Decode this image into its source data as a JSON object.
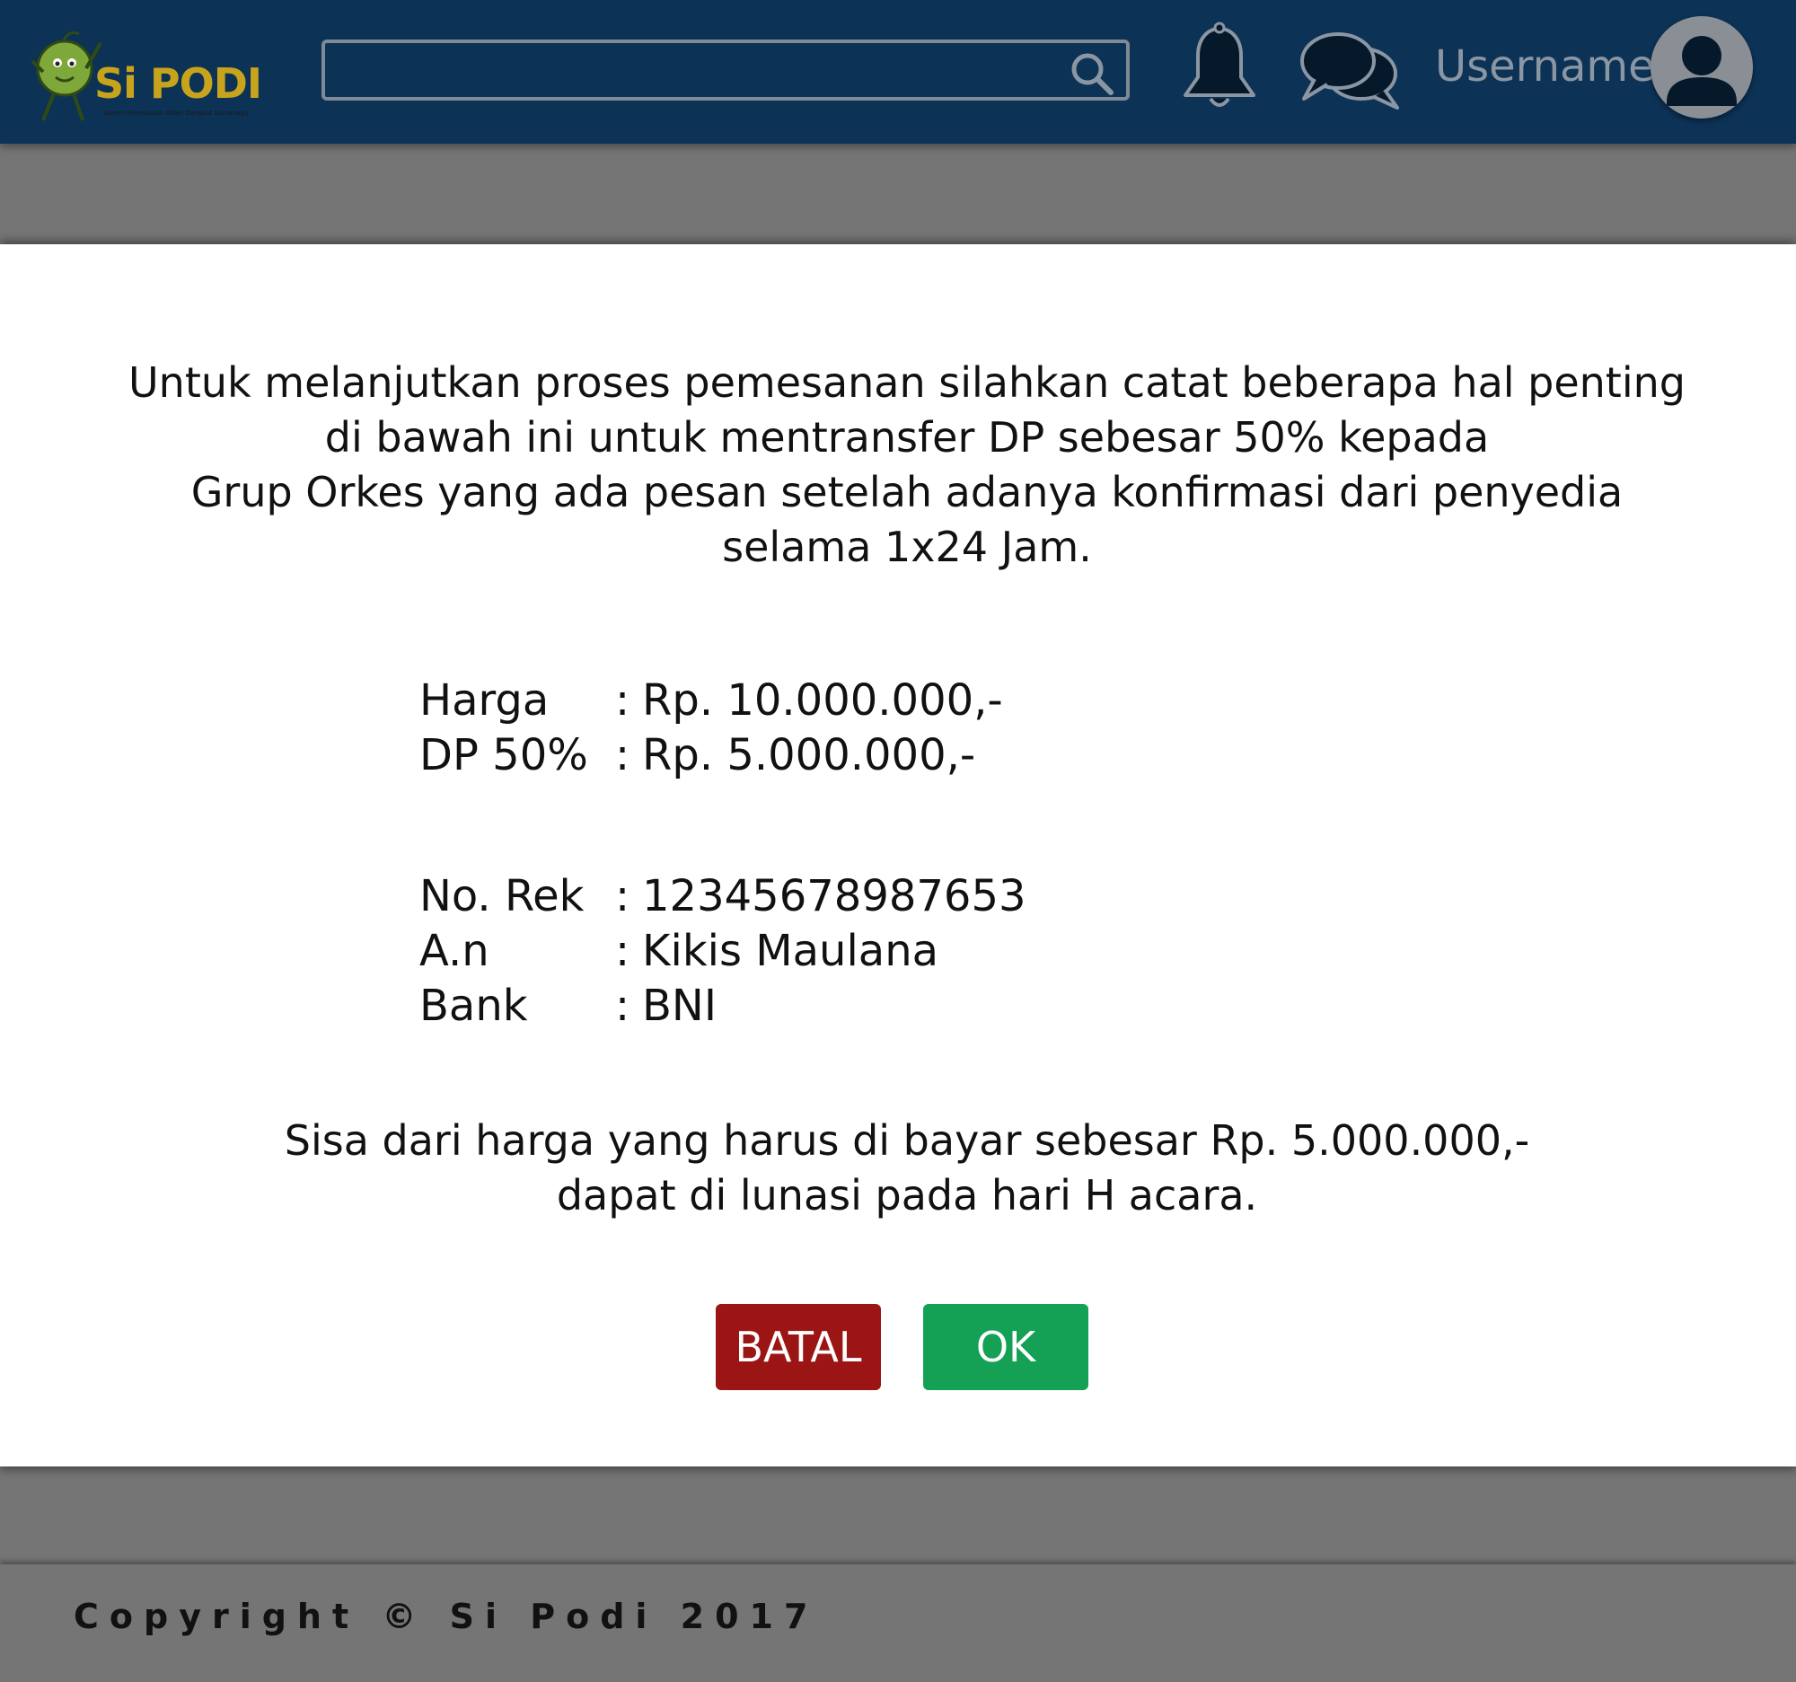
{
  "header": {
    "logo_text": "Si PODI",
    "logo_subtitle": "Sistem Pemesanan Orkes Dangdut Indramayu",
    "search": {
      "value": "",
      "placeholder": ""
    },
    "username": "Username",
    "icons": [
      "search-icon",
      "bell-icon",
      "chat-icon",
      "avatar-icon"
    ]
  },
  "dialog": {
    "intro_lines": [
      "Untuk melanjutkan proses pemesanan silahkan catat beberapa hal penting",
      "di bawah ini untuk mentransfer DP sebesar 50% kepada",
      "Grup Orkes yang ada pesan setelah adanya konfirmasi dari penyedia",
      "selama 1x24 Jam."
    ],
    "price_rows": [
      {
        "label": "Harga",
        "colon": ":",
        "value": "Rp. 10.000.000,-"
      },
      {
        "label": "DP 50%",
        "colon": ":",
        "value": "Rp. 5.000.000,-"
      }
    ],
    "bank_rows": [
      {
        "label": "No. Rek",
        "colon": ":",
        "value": "12345678987653"
      },
      {
        "label": "A.n",
        "colon": ":",
        "value": "Kikis Maulana"
      },
      {
        "label": "Bank",
        "colon": ":",
        "value": "BNI"
      }
    ],
    "outro_lines": [
      "Sisa dari harga yang harus di bayar sebesar Rp. 5.000.000,-",
      "dapat di lunasi pada hari H acara."
    ],
    "buttons": {
      "cancel_label": "BATAL",
      "ok_label": "OK"
    }
  },
  "footer": {
    "copyright": "Copyright © Si Podi 2017"
  },
  "colors": {
    "header_bg": "#0c3256",
    "overlay_bg": "#757575",
    "dialog_bg": "#ffffff",
    "cancel_button": "#9b1515",
    "ok_button": "#14a055",
    "logo_accent": "#c8a41c"
  }
}
